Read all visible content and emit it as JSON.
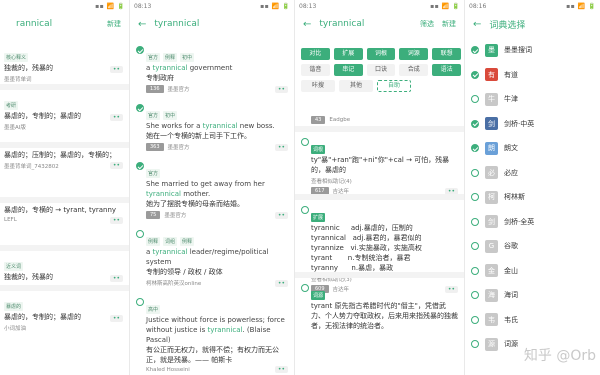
{
  "panel1": {
    "status_time": "",
    "status_right": "",
    "title": "rannical",
    "action": "新建",
    "entries": [
      {
        "tag": "核心释义",
        "zh": "独裁的，残暴的",
        "src": "墨墨背单词"
      },
      {
        "tag": "考研",
        "zh": "暴虐的，专制的；暴虐的",
        "src": "墨墨AI版"
      },
      {
        "zh": "暴虐的；压制的；暴虐的，专横的；",
        "src": "墨墨背单词_7432802"
      },
      {
        "zh": "暴虐的，专横的 → tyrant, tyranny",
        "src": "LEFL"
      },
      {
        "tag": "近义词",
        "zh": "独裁的，残暴的",
        "src": "小红书瞳瞳"
      },
      {
        "tag": "暴虐的",
        "zh": "暴虐的，专制的；暴虐的",
        "src": "小词加油"
      }
    ],
    "dots": "••"
  },
  "panel2": {
    "status_time": "08:13",
    "title": "tyrannical",
    "entries": [
      {
        "tags": [
          "官方",
          "例释",
          "初中"
        ],
        "en_pre": "a ",
        "en_hl": "tyrannical",
        "en_post": " government",
        "zh": "专制政府",
        "count": "136",
        "src": "墨墨官方"
      },
      {
        "tags": [
          "官方",
          "初中"
        ],
        "en_pre": "She works for a ",
        "en_hl": "tyrannical",
        "en_post": " new boss.",
        "zh": "她在一个专横的新上司手下工作。",
        "count": "363",
        "src": "墨墨官方"
      },
      {
        "tags": [
          "官方"
        ],
        "en_pre": "She married to get away from her ",
        "en_hl": "tyrannical",
        "en_post": " mother.",
        "zh": "她为了摆脱专横的母亲而结婚。",
        "count": "75",
        "src": "墨墨官方"
      },
      {
        "tags": [
          "例释",
          "词组",
          "例释"
        ],
        "en_pre": "a ",
        "en_hl": "tyrannical",
        "en_post": " leader/regime/political system",
        "zh": "专制的领导 / 政权 / 政体",
        "count": "",
        "src": "柯林斯高阶英汉online"
      },
      {
        "tags": [
          "高中"
        ],
        "en_pre": "Justice without force is powerless; force without justice is ",
        "en_hl": "tyrannical",
        "en_post": ". (Blaise Pascal)",
        "zh": "有公正而无权力，就得不偿；有权力而无公正，就是残暴。—— 帕斯卡",
        "count": "",
        "src": "Khaled Hosseini"
      }
    ],
    "dots": "••"
  },
  "panel3": {
    "status_time": "08:13",
    "title": "tyrannical",
    "action1": "筛选",
    "action2": "新建",
    "chips": [
      [
        {
          "label": "对比",
          "on": true
        },
        {
          "label": "扩展",
          "on": true
        },
        {
          "label": "词根",
          "on": true
        },
        {
          "label": "词源",
          "on": true
        },
        {
          "label": "联想",
          "on": true
        }
      ],
      [
        {
          "label": "谐音",
          "on": false
        },
        {
          "label": "串记",
          "on": true
        },
        {
          "label": "口诀",
          "on": false
        },
        {
          "label": "合成",
          "on": false
        },
        {
          "label": "语法",
          "on": true
        }
      ],
      [
        {
          "label": "咔搜",
          "on": false
        },
        {
          "label": "其他",
          "on": false
        },
        {
          "label": "自助",
          "on": false,
          "dash": true
        }
      ]
    ],
    "entries": [
      {
        "count": "43",
        "src": "Eadgbe"
      },
      {
        "tag": "词根",
        "zh": "ty\"暴\"+ran\"跑\"+ni\"你\"+cal → 可怕，残暴的，暴虐的",
        "link": "查看相似助记(4)",
        "count": "617",
        "src": "吉达年"
      },
      {
        "tag": "扩展",
        "lines": [
          "tyrannic     adj.暴虐的，压制的",
          "tyrannical   adj.暴君的，暴君似的",
          "tyrannize   vi.实施暴政，实施高权",
          "tyrant       n.专制统治者，暴君",
          "tyranny      n.暴虐，暴政"
        ],
        "link": "查看相似助记(3)",
        "count": "609",
        "src": "吉达年"
      },
      {
        "tag": "词源",
        "zh": "tyrant 原先指古希腊时代的\"僭主\"，凭借武力、个人势力夺取政权，后来用来指残暴的独裁者，无视法律的统治者。",
        "src": ""
      }
    ],
    "dots": "••"
  },
  "panel4": {
    "status_time": "08:16",
    "title": "词典选择",
    "dicts": [
      {
        "name": "墨墨搜词",
        "on": true,
        "color": "#3cae7c",
        "glyph": "墨"
      },
      {
        "name": "有道",
        "on": true,
        "color": "#d94a3b",
        "glyph": "有"
      },
      {
        "name": "牛津",
        "on": false,
        "color": "#c8c8c8",
        "glyph": "牛"
      },
      {
        "name": "剑桥·中英",
        "on": true,
        "color": "#4a6fa5",
        "glyph": "剑"
      },
      {
        "name": "朗文",
        "on": true,
        "color": "#6aa0d8",
        "glyph": "朗"
      },
      {
        "name": "必应",
        "on": false,
        "color": "#c8c8c8",
        "glyph": "必"
      },
      {
        "name": "柯林斯",
        "on": false,
        "color": "#c8c8c8",
        "glyph": "柯"
      },
      {
        "name": "剑桥·全英",
        "on": false,
        "color": "#c8c8c8",
        "glyph": "剑"
      },
      {
        "name": "谷歌",
        "on": false,
        "color": "#c8c8c8",
        "glyph": "G"
      },
      {
        "name": "金山",
        "on": false,
        "color": "#c8c8c8",
        "glyph": "金"
      },
      {
        "name": "海词",
        "on": false,
        "color": "#c8c8c8",
        "glyph": "海"
      },
      {
        "name": "韦氏",
        "on": false,
        "color": "#c8c8c8",
        "glyph": "韦"
      },
      {
        "name": "词源",
        "on": false,
        "color": "#c8c8c8",
        "glyph": "源"
      }
    ]
  },
  "watermark": "知乎 @Orb"
}
